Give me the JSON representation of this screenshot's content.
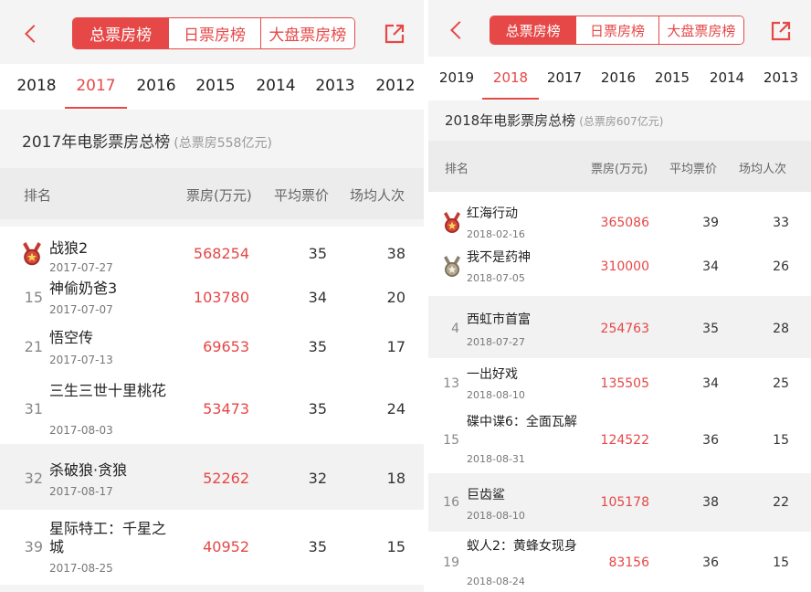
{
  "left": {
    "nav": {
      "tabs": [
        "总票房榜",
        "日票房榜",
        "大盘票房榜"
      ],
      "active_tab": 0,
      "years": [
        "2018",
        "2017",
        "2016",
        "2015",
        "2014",
        "2013",
        "2012"
      ],
      "active_year": 1
    },
    "title": "2017年电影票房总榜",
    "subtitle": "(总票房558亿元)",
    "columns": [
      "排名",
      "票房(万元)",
      "平均票价",
      "场均人次"
    ],
    "rows": [
      {
        "rank": "",
        "medal": "gold",
        "name": "战狼2",
        "date": "2017-07-27",
        "box": "568254",
        "price": "35",
        "people": "38"
      },
      {
        "rank": "15",
        "medal": "",
        "name": "神偷奶爸3",
        "date": "2017-07-07",
        "box": "103780",
        "price": "34",
        "people": "20"
      },
      {
        "rank": "21",
        "medal": "",
        "name": "悟空传",
        "date": "2017-07-13",
        "box": "69653",
        "price": "35",
        "people": "17"
      },
      {
        "rank": "31",
        "medal": "",
        "name": "三生三世十里桃花",
        "date": "2017-08-03",
        "box": "53473",
        "price": "35",
        "people": "24"
      },
      {
        "rank": "32",
        "medal": "",
        "name": "杀破狼·贪狼",
        "date": "2017-08-17",
        "box": "52262",
        "price": "32",
        "people": "18"
      },
      {
        "rank": "39",
        "medal": "",
        "name": "星际特工：千星之城",
        "date": "2017-08-25",
        "box": "40952",
        "price": "35",
        "people": "15"
      }
    ]
  },
  "right": {
    "nav": {
      "tabs": [
        "总票房榜",
        "日票房榜",
        "大盘票房榜"
      ],
      "active_tab": 0,
      "years": [
        "2019",
        "2018",
        "2017",
        "2016",
        "2015",
        "2014",
        "2013"
      ],
      "active_year": 1
    },
    "title": "2018年电影票房总榜",
    "subtitle": "(总票房607亿元)",
    "columns": [
      "排名",
      "票房(万元)",
      "平均票价",
      "场均人次"
    ],
    "rows": [
      {
        "rank": "",
        "medal": "gold",
        "name": "红海行动",
        "date": "2018-02-16",
        "box": "365086",
        "price": "39",
        "people": "33"
      },
      {
        "rank": "",
        "medal": "silver",
        "name": "我不是药神",
        "date": "2018-07-05",
        "box": "310000",
        "price": "34",
        "people": "26"
      },
      {
        "rank": "4",
        "medal": "",
        "name": "西虹市首富",
        "date": "2018-07-27",
        "box": "254763",
        "price": "35",
        "people": "28"
      },
      {
        "rank": "13",
        "medal": "",
        "name": "一出好戏",
        "date": "2018-08-10",
        "box": "135505",
        "price": "34",
        "people": "25"
      },
      {
        "rank": "15",
        "medal": "",
        "name": "碟中谍6：全面瓦解",
        "date": "2018-08-31",
        "box": "124522",
        "price": "36",
        "people": "15"
      },
      {
        "rank": "16",
        "medal": "",
        "name": "巨齿鲨",
        "date": "2018-08-10",
        "box": "105178",
        "price": "38",
        "people": "22"
      },
      {
        "rank": "19",
        "medal": "",
        "name": "蚁人2：黄蜂女现身",
        "date": "2018-08-24",
        "box": "83156",
        "price": "36",
        "people": "15"
      }
    ]
  },
  "colors": {
    "accent": "#e54847",
    "gold": "#c6392f",
    "silver": "#9a9080"
  },
  "icons": {
    "back": "chevron-left-icon",
    "share": "share-icon",
    "medal": "medal-icon"
  }
}
